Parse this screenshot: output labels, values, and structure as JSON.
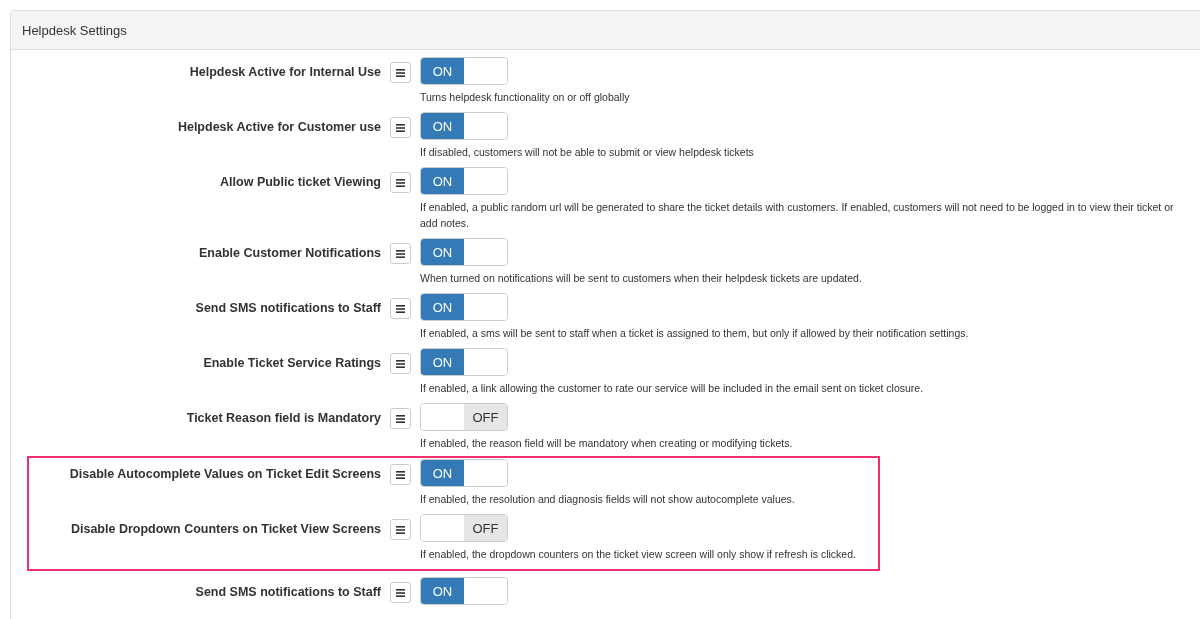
{
  "panel": {
    "title": "Helpdesk Settings"
  },
  "groups": [
    {
      "highlighted": false,
      "settings": [
        {
          "label": "Helpdesk Active for Internal Use",
          "on": true,
          "state_text": "ON",
          "help": "Turns helpdesk functionality on or off globally"
        },
        {
          "label": "Helpdesk Active for Customer use",
          "on": true,
          "state_text": "ON",
          "help": "If disabled, customers will not be able to submit or view helpdesk tickets"
        },
        {
          "label": "Allow Public ticket Viewing",
          "on": true,
          "state_text": "ON",
          "help": "If enabled, a public random url will be generated to share the ticket details with customers. If enabled, customers will not need to be logged in to view their ticket or add notes."
        },
        {
          "label": "Enable Customer Notifications",
          "on": true,
          "state_text": "ON",
          "help": "When turned on notifications will be sent to customers when their helpdesk tickets are updated."
        },
        {
          "label": "Send SMS notifications to Staff",
          "on": true,
          "state_text": "ON",
          "help": "If enabled, a sms will be sent to staff when a ticket is assigned to them, but only if allowed by their notification settings."
        },
        {
          "label": "Enable Ticket Service Ratings",
          "on": true,
          "state_text": "ON",
          "help": "If enabled, a link allowing the customer to rate our service will be included in the email sent on ticket closure."
        },
        {
          "label": "Ticket Reason field is Mandatory",
          "on": false,
          "state_text": "OFF",
          "help": "If enabled, the reason field will be mandatory when creating or modifying tickets."
        }
      ]
    },
    {
      "highlighted": true,
      "settings": [
        {
          "label": "Disable Autocomplete Values on Ticket Edit Screens",
          "on": true,
          "state_text": "ON",
          "help": "If enabled, the resolution and diagnosis fields will not show autocomplete values."
        },
        {
          "label": "Disable Dropdown Counters on Ticket View Screens",
          "on": false,
          "state_text": "OFF",
          "help": "If enabled, the dropdown counters on the ticket view screen will only show if refresh is clicked."
        }
      ]
    },
    {
      "highlighted": false,
      "settings": [
        {
          "label": "Send SMS notifications to Staff",
          "on": true,
          "state_text": "ON"
        }
      ]
    }
  ]
}
